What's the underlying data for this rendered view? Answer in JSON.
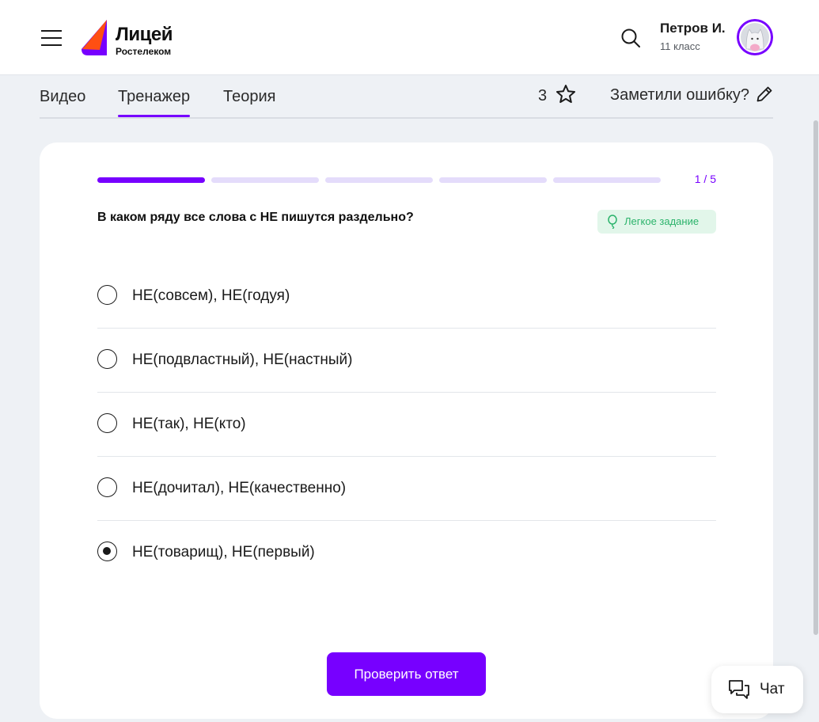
{
  "header": {
    "logo": {
      "title": "Лицей",
      "subtitle": "Ростелеком"
    },
    "user": {
      "name": "Петров И.",
      "class_label": "11 класс"
    }
  },
  "tabs": [
    {
      "label": "Видео",
      "active": false
    },
    {
      "label": "Тренажер",
      "active": true
    },
    {
      "label": "Теория",
      "active": false
    }
  ],
  "toolbar": {
    "stars_count": "3",
    "report_label": "Заметили ошибку?"
  },
  "task": {
    "progress": {
      "total": 5,
      "current": 1,
      "label": "1 / 5"
    },
    "question": "В каком ряду все слова с НЕ пишутся раздельно?",
    "difficulty": "Легкое задание",
    "options": [
      {
        "label": "НЕ(совсем), НЕ(годуя)",
        "selected": false
      },
      {
        "label": "НЕ(подвластный), НЕ(настный)",
        "selected": false
      },
      {
        "label": "НЕ(так), НЕ(кто)",
        "selected": false
      },
      {
        "label": "НЕ(дочитал), НЕ(качественно)",
        "selected": false
      },
      {
        "label": "НЕ(товарищ), НЕ(первый)",
        "selected": true
      }
    ],
    "submit_label": "Проверить ответ"
  },
  "chat": {
    "label": "Чат"
  },
  "colors": {
    "accent": "#7700ff",
    "accent_light": "#e4dcfb",
    "success": "#2bb36b",
    "success_bg": "#e2f6ea",
    "logo_orange": "#ff4f12"
  }
}
